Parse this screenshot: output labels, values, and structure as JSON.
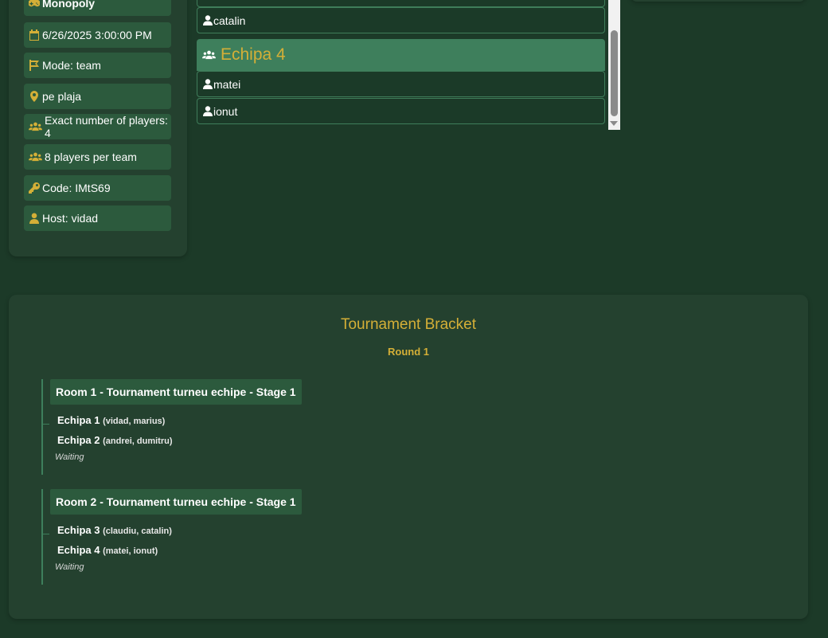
{
  "info": {
    "game": "Monopoly",
    "datetime": "6/26/2025 3:00:00 PM",
    "mode": "Mode: team",
    "location": "pe plaja",
    "players_exact": "Exact number of players: 4",
    "players_per_team": "8 players per team",
    "code": "Code: IMtS69",
    "host": "Host: vidad"
  },
  "teams_panel": {
    "prev_player_1": "",
    "prev_player_2": "catalin",
    "team4": {
      "name": "Echipa 4",
      "players": [
        "matei",
        "ionut"
      ]
    }
  },
  "bracket": {
    "title": "Tournament Bracket",
    "round": "Round 1",
    "matches": [
      {
        "header": "Room 1 - Tournament turneu echipe - Stage 1",
        "team_a": {
          "name": "Echipa 1",
          "members": "(vidad, marius)"
        },
        "team_b": {
          "name": "Echipa 2",
          "members": "(andrei, dumitru)"
        },
        "status": "Waiting"
      },
      {
        "header": "Room 2 - Tournament turneu echipe - Stage 1",
        "team_a": {
          "name": "Echipa 3",
          "members": "(claudiu, catalin)"
        },
        "team_b": {
          "name": "Echipa 4",
          "members": "(matei, ionut)"
        },
        "status": "Waiting"
      }
    ]
  },
  "colors": {
    "accent": "#d4af37",
    "background": "#1c3a28",
    "card": "#24412f",
    "item": "#2c5a3d",
    "team_header": "#3e7f5c"
  }
}
